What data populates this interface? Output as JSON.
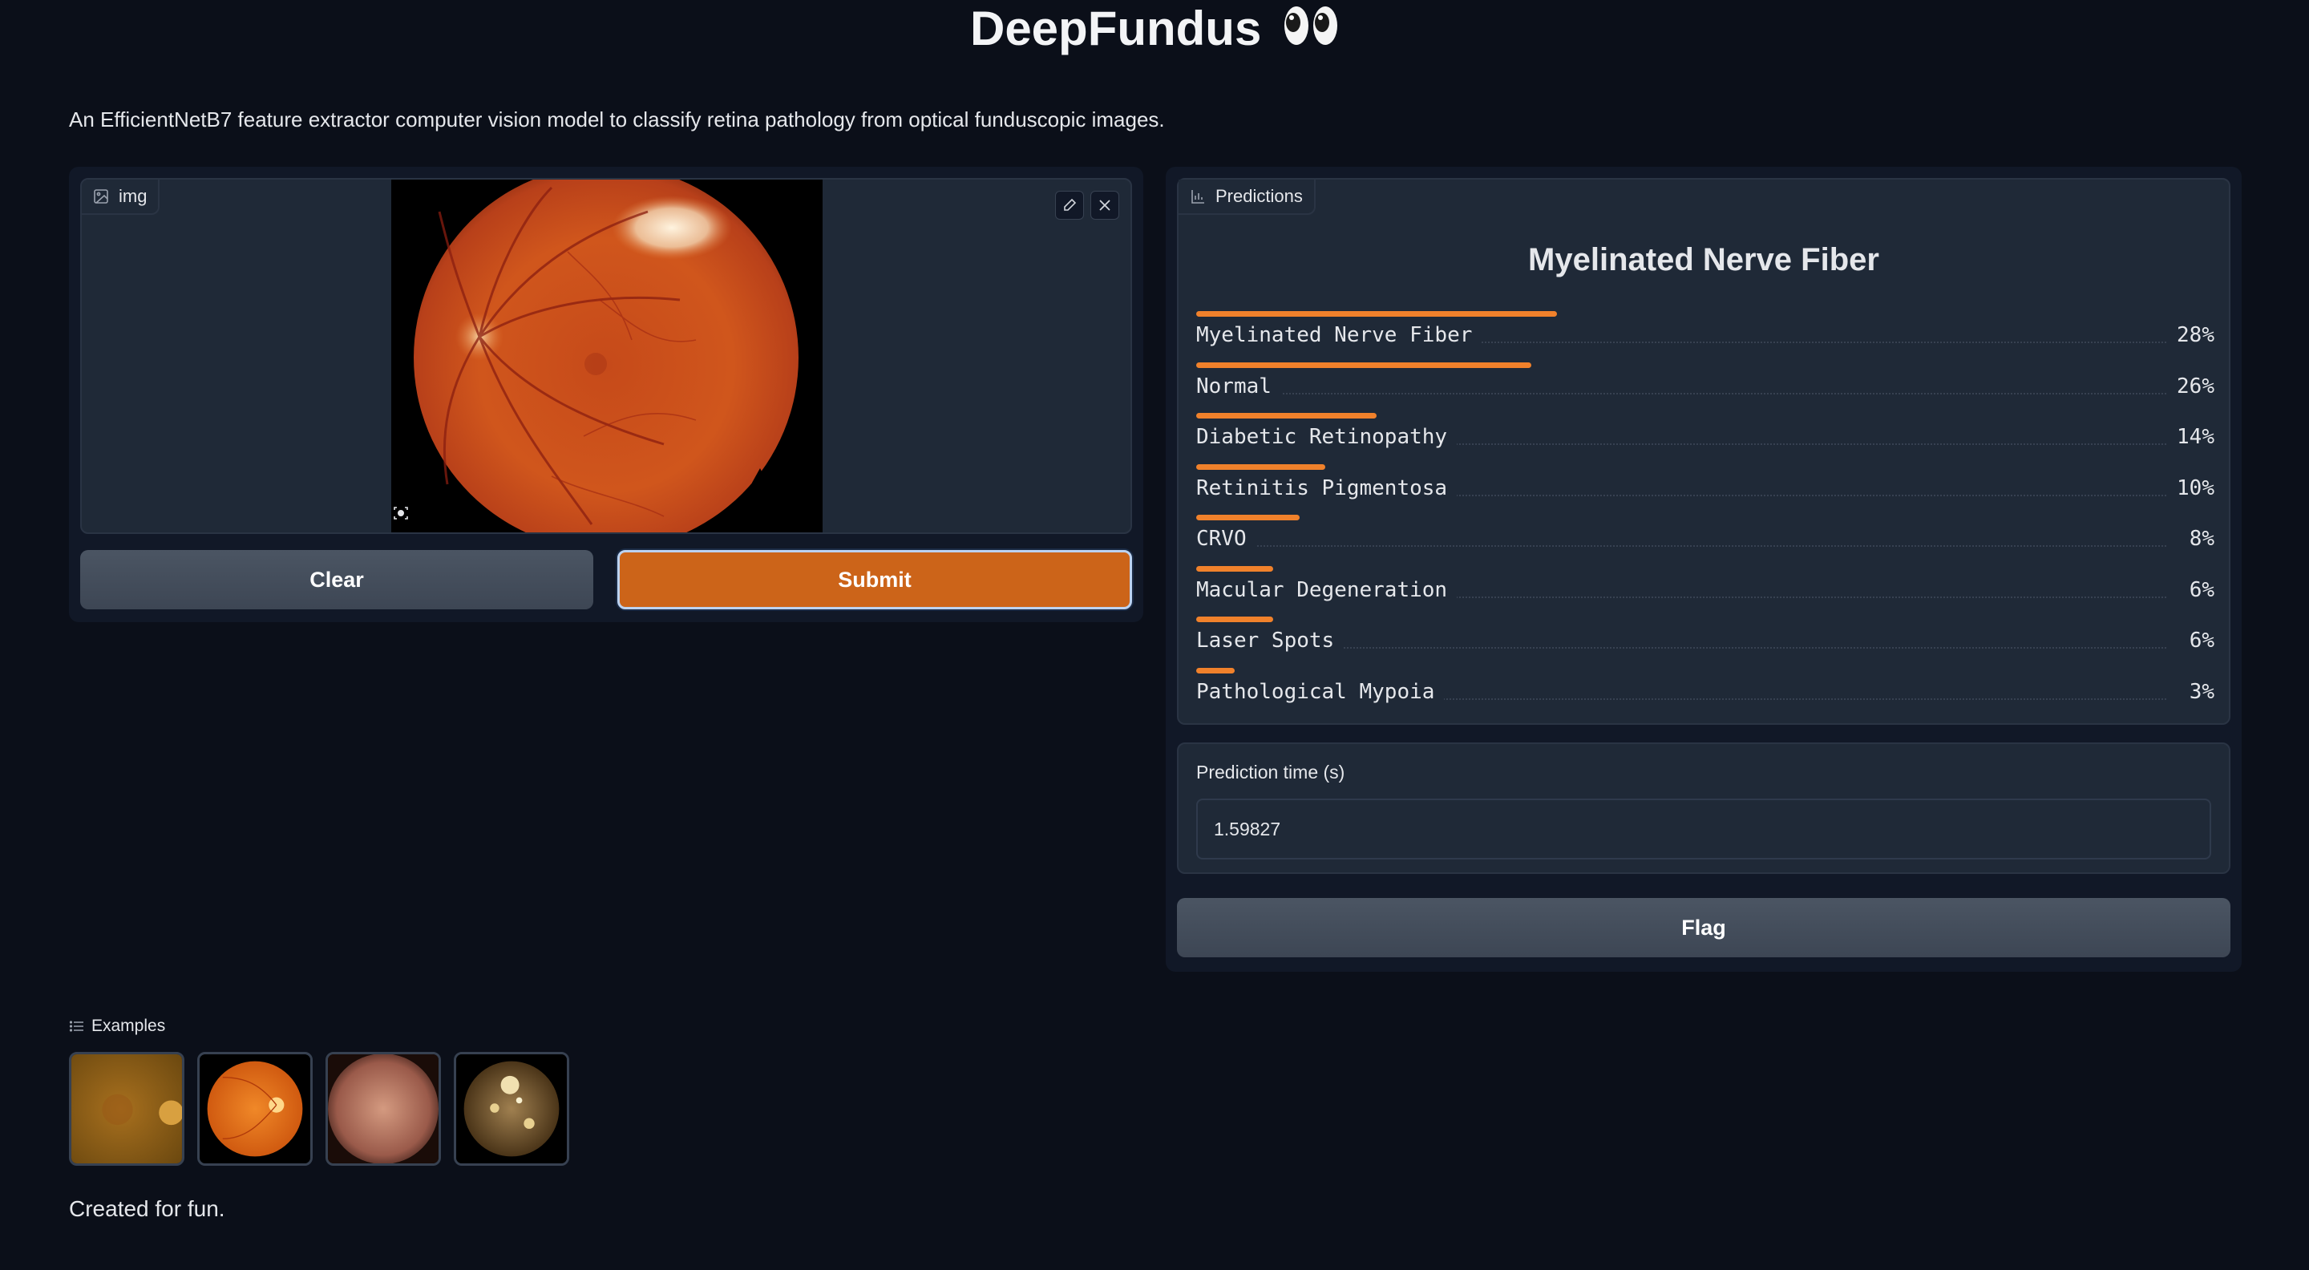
{
  "header": {
    "title": "DeepFundus",
    "emoji": "👀",
    "description": "An EfficientNetB7 feature extractor computer vision model to classify retina pathology from optical funduscopic images."
  },
  "input": {
    "image_label": "img",
    "image_icon": "image-icon",
    "clear_label": "Clear",
    "submit_label": "Submit"
  },
  "output": {
    "predictions_label": "Predictions",
    "predictions_icon": "bar-chart-icon",
    "top_prediction": "Myelinated Nerve Fiber",
    "predictions": [
      {
        "label": "Myelinated Nerve Fiber",
        "percent": "28%",
        "value": 0.28
      },
      {
        "label": "Normal",
        "percent": "26%",
        "value": 0.26
      },
      {
        "label": "Diabetic Retinopathy",
        "percent": "14%",
        "value": 0.14
      },
      {
        "label": "Retinitis Pigmentosa",
        "percent": "10%",
        "value": 0.1
      },
      {
        "label": "CRVO",
        "percent": "8%",
        "value": 0.08
      },
      {
        "label": "Macular Degeneration",
        "percent": "6%",
        "value": 0.06
      },
      {
        "label": "Laser Spots",
        "percent": "6%",
        "value": 0.06
      },
      {
        "label": "Pathological Mypoia",
        "percent": "3%",
        "value": 0.03
      }
    ],
    "time_label": "Prediction time (s)",
    "time_value": "1.59827",
    "flag_label": "Flag"
  },
  "examples": {
    "label": "Examples",
    "icon": "list-icon"
  },
  "footer": {
    "text": "Created for fun."
  },
  "colors": {
    "accent": "#f0812b",
    "submit": "#cc6419",
    "background": "#0b0f19"
  }
}
